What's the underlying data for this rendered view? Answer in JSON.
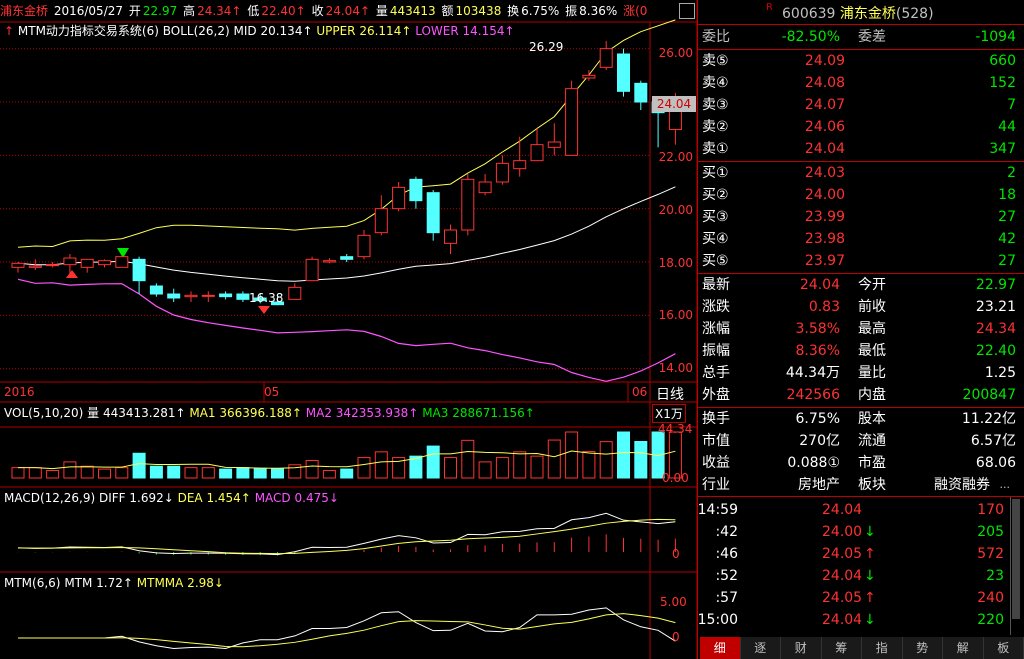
{
  "header": {
    "name": "浦东金桥",
    "date": "2016/05/27",
    "open_label": "开",
    "open": "22.97",
    "high_label": "高",
    "high": "24.34↑",
    "low_label": "低",
    "low": "22.40↑",
    "close_label": "收",
    "close": "24.04↑",
    "vol_label": "量",
    "vol": "443413",
    "amt_label": "额",
    "amt": "103438",
    "turnover_label": "换",
    "turnover": "6.75%",
    "amp_label": "振",
    "amp": "8.36%",
    "chg_label": "涨(0"
  },
  "main_chart": {
    "indicator": "MTM动力指标交易系统(6)",
    "boll": "BOLL(26,2)",
    "mid": "MID 20.134↑",
    "upper": "UPPER 26.114↑",
    "lower": "LOWER 14.154↑",
    "max_label": "26.29",
    "min_label": "16.38",
    "current_price": "24.04",
    "y_ticks": [
      "26.00",
      "24.00",
      "22.00",
      "20.00",
      "18.00",
      "16.00",
      "14.00"
    ],
    "x_labels": {
      "left": "2016",
      "mid": "05",
      "right": "06"
    },
    "period": "日线"
  },
  "vol_panel": {
    "title": "VOL(5,10,20)",
    "vol": "量 443413.281↑",
    "ma1": "MA1 366396.188↑",
    "ma2": "MA2 342353.938↑",
    "ma3": "MA3 288671.156↑",
    "unit": "X1万",
    "y_ticks": [
      "44.34",
      "0.00"
    ]
  },
  "macd_panel": {
    "title": "MACD(12,26,9)",
    "diff": "DIFF 1.692↓",
    "dea": "DEA 1.454↑",
    "macd": "MACD 0.475↓",
    "y_ticks": [
      "0"
    ]
  },
  "mtm_panel": {
    "title": "MTM(6,6)",
    "mtm": "MTM 1.72↑",
    "mtmma": "MTMMA 2.98↓",
    "y_ticks": [
      "5.00",
      "0"
    ]
  },
  "chart_data": {
    "type": "candlestick",
    "title": "浦东金桥",
    "candles": [
      {
        "o": 17.8,
        "c": 17.95,
        "h": 18.0,
        "l": 17.6
      },
      {
        "o": 17.8,
        "c": 17.85,
        "h": 18.1,
        "l": 17.7
      },
      {
        "o": 17.9,
        "c": 17.9,
        "h": 18.0,
        "l": 17.8
      },
      {
        "o": 17.9,
        "c": 18.15,
        "h": 18.3,
        "l": 17.5
      },
      {
        "o": 17.8,
        "c": 18.1,
        "h": 18.1,
        "l": 17.6
      },
      {
        "o": 17.9,
        "c": 18.05,
        "h": 18.1,
        "l": 17.8
      },
      {
        "o": 17.8,
        "c": 18.2,
        "h": 18.2,
        "l": 17.8
      },
      {
        "o": 18.1,
        "c": 17.3,
        "h": 18.2,
        "l": 16.8
      },
      {
        "o": 17.1,
        "c": 16.8,
        "h": 17.2,
        "l": 16.7
      },
      {
        "o": 16.8,
        "c": 16.65,
        "h": 17.0,
        "l": 16.5
      },
      {
        "o": 16.7,
        "c": 16.75,
        "h": 16.9,
        "l": 16.5
      },
      {
        "o": 16.75,
        "c": 16.75,
        "h": 16.9,
        "l": 16.5
      },
      {
        "o": 16.8,
        "c": 16.7,
        "h": 16.9,
        "l": 16.6
      },
      {
        "o": 16.8,
        "c": 16.6,
        "h": 16.9,
        "l": 16.5
      },
      {
        "o": 16.65,
        "c": 16.55,
        "h": 16.8,
        "l": 16.45
      },
      {
        "o": 16.5,
        "c": 16.4,
        "h": 16.7,
        "l": 16.38
      },
      {
        "o": 16.6,
        "c": 17.05,
        "h": 17.2,
        "l": 16.6
      },
      {
        "o": 17.3,
        "c": 18.1,
        "h": 18.2,
        "l": 17.3
      },
      {
        "o": 18.0,
        "c": 18.05,
        "h": 18.15,
        "l": 17.95
      },
      {
        "o": 18.2,
        "c": 18.1,
        "h": 18.3,
        "l": 18.0
      },
      {
        "o": 18.2,
        "c": 19.0,
        "h": 19.2,
        "l": 18.1
      },
      {
        "o": 19.1,
        "c": 20.0,
        "h": 20.5,
        "l": 19.0
      },
      {
        "o": 20.0,
        "c": 20.8,
        "h": 21.0,
        "l": 19.9
      },
      {
        "o": 21.1,
        "c": 20.3,
        "h": 21.2,
        "l": 20.0
      },
      {
        "o": 20.6,
        "c": 19.1,
        "h": 20.7,
        "l": 18.8
      },
      {
        "o": 18.7,
        "c": 19.2,
        "h": 19.4,
        "l": 18.3
      },
      {
        "o": 19.2,
        "c": 21.1,
        "h": 21.3,
        "l": 19.0
      },
      {
        "o": 20.6,
        "c": 21.0,
        "h": 21.3,
        "l": 20.5
      },
      {
        "o": 21.0,
        "c": 21.7,
        "h": 22.0,
        "l": 20.9
      },
      {
        "o": 21.5,
        "c": 21.8,
        "h": 22.7,
        "l": 21.2
      },
      {
        "o": 21.8,
        "c": 22.4,
        "h": 23.0,
        "l": 21.8
      },
      {
        "o": 22.3,
        "c": 22.5,
        "h": 23.2,
        "l": 22.0
      },
      {
        "o": 22.0,
        "c": 24.5,
        "h": 24.8,
        "l": 22.0
      },
      {
        "o": 24.9,
        "c": 25.0,
        "h": 25.2,
        "l": 24.8
      },
      {
        "o": 25.3,
        "c": 26.0,
        "h": 26.29,
        "l": 25.2
      },
      {
        "o": 25.8,
        "c": 24.4,
        "h": 26.0,
        "l": 24.2
      },
      {
        "o": 24.7,
        "c": 24.0,
        "h": 24.8,
        "l": 23.7
      },
      {
        "o": 24.0,
        "c": 23.6,
        "h": 24.1,
        "l": 22.3
      },
      {
        "o": 22.97,
        "c": 24.04,
        "h": 24.34,
        "l": 22.4
      }
    ],
    "ylim": [
      13.5,
      27
    ]
  },
  "right_panel": {
    "code": "600639",
    "name": "浦东金桥",
    "rank": "(528)",
    "weibi_label": "委比",
    "weibi": "-82.50%",
    "weicha_label": "委差",
    "weicha": "-1094",
    "asks": [
      {
        "label": "卖⑤",
        "price": "24.09",
        "vol": "660"
      },
      {
        "label": "卖④",
        "price": "24.08",
        "vol": "152"
      },
      {
        "label": "卖③",
        "price": "24.07",
        "vol": "7"
      },
      {
        "label": "卖②",
        "price": "24.06",
        "vol": "44"
      },
      {
        "label": "卖①",
        "price": "24.04",
        "vol": "347"
      }
    ],
    "bids": [
      {
        "label": "买①",
        "price": "24.03",
        "vol": "2"
      },
      {
        "label": "买②",
        "price": "24.00",
        "vol": "18"
      },
      {
        "label": "买③",
        "price": "23.99",
        "vol": "27"
      },
      {
        "label": "买④",
        "price": "23.98",
        "vol": "42"
      },
      {
        "label": "买⑤",
        "price": "23.97",
        "vol": "27"
      }
    ],
    "stats": [
      {
        "l1": "最新",
        "v1": "24.04",
        "l2": "今开",
        "v2": "22.97",
        "c1": "red",
        "c2": "green"
      },
      {
        "l1": "涨跌",
        "v1": "0.83",
        "l2": "前收",
        "v2": "23.21",
        "c1": "red",
        "c2": "white"
      },
      {
        "l1": "涨幅",
        "v1": "3.58%",
        "l2": "最高",
        "v2": "24.34",
        "c1": "red",
        "c2": "red"
      },
      {
        "l1": "振幅",
        "v1": "8.36%",
        "l2": "最低",
        "v2": "22.40",
        "c1": "red",
        "c2": "green"
      },
      {
        "l1": "总手",
        "v1": "44.34万",
        "l2": "量比",
        "v2": "1.25",
        "c1": "white",
        "c2": "white"
      },
      {
        "l1": "外盘",
        "v1": "242566",
        "l2": "内盘",
        "v2": "200847",
        "c1": "red",
        "c2": "green"
      }
    ],
    "stats2": [
      {
        "l1": "换手",
        "v1": "6.75%",
        "l2": "股本",
        "v2": "11.22亿"
      },
      {
        "l1": "市值",
        "v1": "270亿",
        "l2": "流通",
        "v2": "6.57亿"
      },
      {
        "l1": "收益",
        "v1": "0.088①",
        "l2": "市盈",
        "v2": "68.06"
      }
    ],
    "industry_label": "行业",
    "industry": "房地产",
    "sector_label": "板块",
    "sector": "融资融券",
    "more": "...",
    "ticks": [
      {
        "time": "14:59",
        "price": "24.04",
        "arrow": "",
        "vol": "170",
        "pc": "red",
        "vc": "red"
      },
      {
        "time": ":42",
        "price": "24.00",
        "arrow": "↓",
        "vol": "205",
        "pc": "red",
        "vc": "green"
      },
      {
        "time": ":46",
        "price": "24.05",
        "arrow": "↑",
        "vol": "572",
        "pc": "red",
        "vc": "red"
      },
      {
        "time": ":52",
        "price": "24.04",
        "arrow": "↓",
        "vol": "23",
        "pc": "red",
        "vc": "green"
      },
      {
        "time": ":57",
        "price": "24.05",
        "arrow": "↑",
        "vol": "240",
        "pc": "red",
        "vc": "red"
      },
      {
        "time": "15:00",
        "price": "24.04",
        "arrow": "↓",
        "vol": "220",
        "pc": "red",
        "vc": "green"
      }
    ],
    "tabs": [
      "细",
      "逐",
      "财",
      "筹",
      "指",
      "势",
      "解",
      "板"
    ]
  }
}
